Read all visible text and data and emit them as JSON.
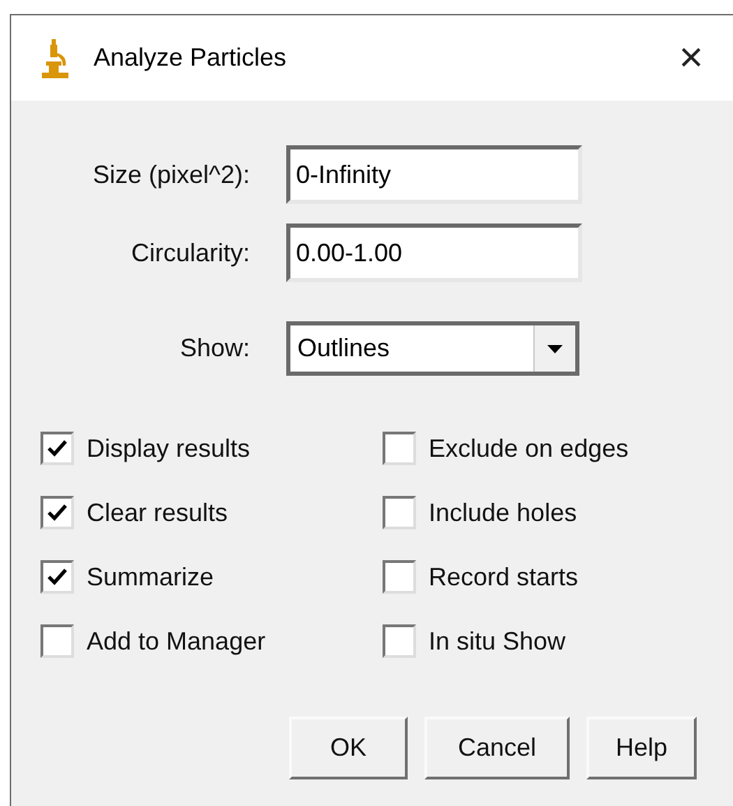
{
  "window": {
    "title": "Analyze Particles",
    "close": "×"
  },
  "fields": [
    {
      "label": "Size (pixel^2):",
      "value": "0-Infinity"
    },
    {
      "label": "Circularity:",
      "value": "0.00-1.00"
    }
  ],
  "show": {
    "label": "Show:",
    "value": "Outlines"
  },
  "checkboxes": [
    {
      "label": "Display results",
      "checked": true
    },
    {
      "label": "Exclude on edges",
      "checked": false
    },
    {
      "label": "Clear results",
      "checked": true
    },
    {
      "label": "Include holes",
      "checked": false
    },
    {
      "label": "Summarize",
      "checked": true
    },
    {
      "label": "Record starts",
      "checked": false
    },
    {
      "label": "Add to Manager",
      "checked": false
    },
    {
      "label": "In situ Show",
      "checked": false
    }
  ],
  "buttons": [
    "OK",
    "Cancel",
    "Help"
  ]
}
